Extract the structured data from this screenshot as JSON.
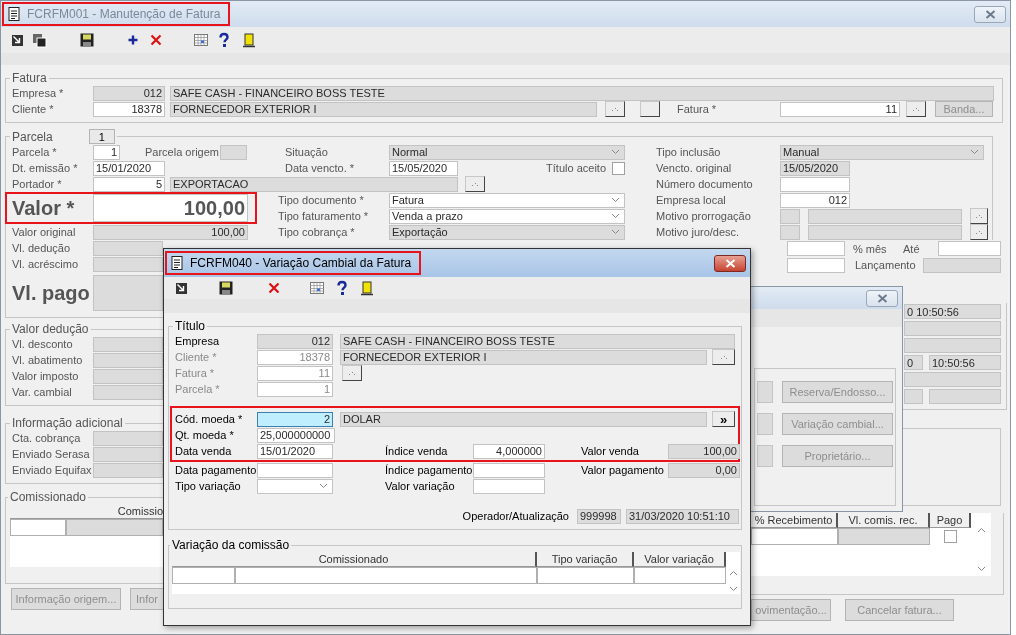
{
  "main": {
    "title": "FCRFM001 - Manutenção de Fatura",
    "fatura": {
      "legend": "Fatura",
      "empresa_label": "Empresa *",
      "empresa_code": {
        "value": "012",
        "readonly": true
      },
      "empresa_name": {
        "value": "SAFE CASH - FINANCEIRO BOSS TESTE",
        "readonly": true
      },
      "cliente_label": "Cliente *",
      "cliente_code": {
        "value": "18378",
        "readonly": false
      },
      "cliente_name": {
        "value": "FORNECEDOR EXTERIOR I",
        "readonly": true
      },
      "fatura_label": "Fatura *",
      "fatura": {
        "value": "11",
        "readonly": false
      },
      "banda_button": {
        "label": "Banda...",
        "disabled": true
      }
    },
    "parcela": {
      "legend": "Parcela",
      "tab": "1",
      "parcela_label": "Parcela *",
      "parcela": {
        "value": "1",
        "readonly": false
      },
      "origem_label": "Parcela origem",
      "situacao_label": "Situação",
      "situacao": {
        "value": "Normal",
        "readonly": true
      },
      "inclusao_label": "Tipo inclusão",
      "inclusao": {
        "value": "Manual",
        "readonly": true
      },
      "emissao_label": "Dt. emissão *",
      "emissao": {
        "value": "15/01/2020",
        "readonly": false
      },
      "vencto_label": "Data vencto. *",
      "vencto": {
        "value": "15/05/2020",
        "readonly": false
      },
      "aceito_label": "Título aceito",
      "aceito": {
        "checked": false
      },
      "vencto_original_label": "Vencto. original",
      "vencto_original": {
        "value": "15/05/2020",
        "readonly": true
      },
      "portador_label": "Portador *",
      "portador_code": {
        "value": "5",
        "readonly": false
      },
      "portador_name": {
        "value": "EXPORTACAO",
        "readonly": true
      },
      "numero_label": "Número documento",
      "valor_label": "Valor *",
      "valor": {
        "value": "100,00",
        "readonly": false
      },
      "valor_original_label": "Valor original",
      "valor_original": {
        "value": "100,00",
        "readonly": true
      },
      "tipo_documento_label": "Tipo documento *",
      "tipo_documento": {
        "value": "Fatura",
        "readonly": false
      },
      "tipo_faturamento_label": "Tipo faturamento *",
      "tipo_faturamento": {
        "value": "Venda a prazo",
        "readonly": false
      },
      "tipo_cobranca_label": "Tipo cobrança *",
      "tipo_cobranca": {
        "value": "Exportação",
        "readonly": true
      },
      "empresa_local_label": "Empresa local",
      "empresa_local": {
        "value": "012",
        "readonly": false
      },
      "prorrogacao_label": "Motivo prorrogação",
      "juro_label": "Motivo juro/desc.",
      "deducao_label": "Vl. dedução",
      "acrescimo_label": "Vl. acréscimo",
      "pago_label": "Vl. pago",
      "mes_label": "% mês",
      "ate_label": "Até",
      "lancamento_label": "Lançamento"
    },
    "times": [
      "0 10:50:56",
      "0",
      "10:50:56"
    ],
    "deducao": {
      "legend": "Valor dedução",
      "labels": [
        "Vl. desconto",
        "Vl. abatimento",
        "Valor imposto",
        "Var. cambial"
      ]
    },
    "adicional": {
      "legend": "Informação adicional",
      "labels": [
        "Cta. cobrança",
        "Enviado Serasa",
        "Enviado Equifax"
      ]
    },
    "comissionado": {
      "legend": "Comissionado",
      "columns": [
        "Comissio",
        "% Recebimento",
        "Vl. comis. rec.",
        "Pago"
      ],
      "pago": {
        "checked": false
      }
    },
    "buttons": [
      {
        "label": "Informação origem...",
        "disabled": true
      },
      {
        "label": "Infor",
        "disabled": true
      },
      {
        "label": "ovimentação...",
        "disabled": true
      },
      {
        "label": "Cancelar fatura...",
        "disabled": true
      }
    ]
  },
  "middle": {
    "buttons": [
      {
        "label": "Reserva/Endosso...",
        "disabled": true
      },
      {
        "label": "Variação cambial...",
        "disabled": true
      },
      {
        "label": "Proprietário...",
        "disabled": true
      }
    ]
  },
  "dialog": {
    "title": "FCRFM040 - Variação Cambial da Fatura",
    "titulo": {
      "legend": "Título",
      "empresa_label": "Empresa",
      "empresa_code": {
        "value": "012",
        "readonly": true
      },
      "empresa_name": {
        "value": "SAFE CASH - FINANCEIRO BOSS TESTE",
        "readonly": true
      },
      "cliente_label": "Cliente *",
      "cliente_code": {
        "value": "18378",
        "readonly": false
      },
      "cliente_name": {
        "value": "FORNECEDOR EXTERIOR I",
        "readonly": true
      },
      "fatura_label": "Fatura *",
      "fatura": {
        "value": "11",
        "readonly": false
      },
      "parcela_label": "Parcela *",
      "parcela": {
        "value": "1",
        "readonly": false
      },
      "key_disabled": true,
      "moeda_label": "Cód. moeda *",
      "moeda_code": {
        "value": "2",
        "focused": true
      },
      "moeda_name": {
        "value": "DOLAR",
        "readonly": true
      },
      "moeda_button": "»",
      "qt_label": "Qt. moeda *",
      "qt": {
        "value": "25,000000000",
        "readonly": false
      },
      "data_venda_label": "Data venda",
      "data_venda": {
        "value": "15/01/2020",
        "readonly": false
      },
      "indice_venda_label": "Índice venda",
      "indice_venda": {
        "value": "4,000000",
        "readonly": false
      },
      "valor_venda_label": "Valor venda",
      "valor_venda": {
        "value": "100,00",
        "readonly": true
      },
      "data_pagamento_label": "Data pagamento",
      "indice_pagamento_label": "Índice pagamento",
      "valor_pagamento_label": "Valor pagamento",
      "valor_pagamento": {
        "value": "0,00",
        "readonly": true
      },
      "tipo_variacao_label": "Tipo variação",
      "valor_variacao_label": "Valor variação",
      "operador_label": "Operador/Atualização",
      "operador": {
        "value": "999998",
        "readonly": true
      },
      "atualizacao": {
        "value": "31/03/2020 10:51:10",
        "readonly": true
      }
    },
    "comissao": {
      "legend": "Variação da comissão",
      "columns": [
        "Comissionado",
        "Tipo variação",
        "Valor variação"
      ]
    }
  }
}
